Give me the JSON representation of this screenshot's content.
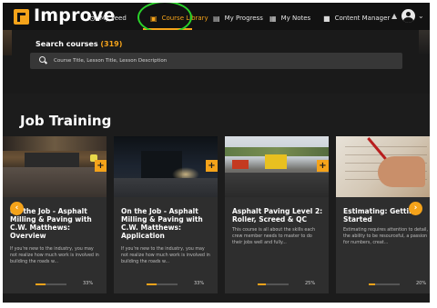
{
  "header": {
    "brand": "Improve",
    "nav": [
      {
        "label": "My Feed",
        "icon": "play-circle-icon"
      },
      {
        "label": "Course Library",
        "icon": "library-icon"
      },
      {
        "label": "My Progress",
        "icon": "progress-icon"
      },
      {
        "label": "My Notes",
        "icon": "notes-icon"
      },
      {
        "label": "Content Manager",
        "icon": "folder-icon"
      }
    ],
    "active_nav": "Course Library",
    "highlight_color": "#2ad12a",
    "accent_color": "#f5a31a"
  },
  "search": {
    "title": "Search courses",
    "count": "(319)",
    "placeholder": "Course Title, Lesson Title, Lesson Description"
  },
  "section": {
    "title": "Job Training"
  },
  "courses": [
    {
      "title": "On the Job - Asphalt Milling & Paving with C.W. Matthews: Overview",
      "description": "If you're new to the industry, you may not realize how much work is involved in building the roads w...",
      "progress_label": "33%",
      "progress": 0.33
    },
    {
      "title": "On the Job - Asphalt Milling & Paving with C.W. Matthews: Application",
      "description": "If you're new to the industry, you may not realize how much work is involved in building the roads w...",
      "progress_label": "33%",
      "progress": 0.33
    },
    {
      "title": "Asphalt Paving Level 2: Roller, Screed & QC",
      "description": "This course is all about the skills each crew member needs to master to do their jobs well and fully...",
      "progress_label": "25%",
      "progress": 0.25
    },
    {
      "title": "Estimating: Getting Started",
      "description": "Estimating requires attention to detail, the ability to be resourceful, a passion for numbers, creat...",
      "progress_label": "20%",
      "progress": 0.2
    }
  ],
  "icons": {
    "plus": "+",
    "prev": "‹",
    "next": "›",
    "bell": "🔔",
    "caret": "⌄"
  }
}
